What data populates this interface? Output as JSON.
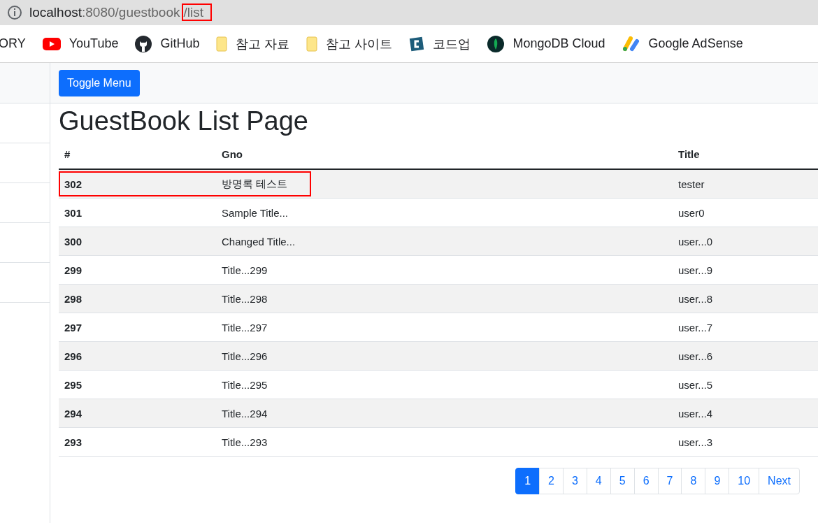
{
  "address_bar": {
    "host": "localhost",
    "path": ":8080/guestbook",
    "highlighted_part": "/list"
  },
  "bookmarks": [
    {
      "kind": "text",
      "label": "ORY"
    },
    {
      "kind": "youtube",
      "label": "YouTube"
    },
    {
      "kind": "github",
      "label": "GitHub"
    },
    {
      "kind": "folder",
      "label": "참고 자료"
    },
    {
      "kind": "folder",
      "label": "참고 사이트"
    },
    {
      "kind": "codeup",
      "label": "코드업"
    },
    {
      "kind": "mongodb",
      "label": "MongoDB Cloud"
    },
    {
      "kind": "adsense",
      "label": "Google AdSense"
    }
  ],
  "toggle_button": "Toggle Menu",
  "page_title": "GuestBook List Page",
  "table": {
    "columns": [
      "#",
      "Gno",
      "Title"
    ],
    "rows": [
      {
        "cells": [
          "302",
          "방명록 테스트",
          "tester"
        ],
        "highlighted": true
      },
      {
        "cells": [
          "301",
          "Sample Title...",
          "user0"
        ],
        "highlighted": false
      },
      {
        "cells": [
          "300",
          "Changed Title...",
          "user...0"
        ],
        "highlighted": false
      },
      {
        "cells": [
          "299",
          "Title...299",
          "user...9"
        ],
        "highlighted": false
      },
      {
        "cells": [
          "298",
          "Title...298",
          "user...8"
        ],
        "highlighted": false
      },
      {
        "cells": [
          "297",
          "Title...297",
          "user...7"
        ],
        "highlighted": false
      },
      {
        "cells": [
          "296",
          "Title...296",
          "user...6"
        ],
        "highlighted": false
      },
      {
        "cells": [
          "295",
          "Title...295",
          "user...5"
        ],
        "highlighted": false
      },
      {
        "cells": [
          "294",
          "Title...294",
          "user...4"
        ],
        "highlighted": false
      },
      {
        "cells": [
          "293",
          "Title...293",
          "user...3"
        ],
        "highlighted": false
      }
    ]
  },
  "pagination": [
    {
      "label": "1",
      "selected": true
    },
    {
      "label": "2",
      "selected": false
    },
    {
      "label": "3",
      "selected": false
    },
    {
      "label": "4",
      "selected": false
    },
    {
      "label": "5",
      "selected": false
    },
    {
      "label": "6",
      "selected": false
    },
    {
      "label": "7",
      "selected": false
    },
    {
      "label": "8",
      "selected": false
    },
    {
      "label": "9",
      "selected": false
    },
    {
      "label": "10",
      "selected": false
    },
    {
      "label": "Next",
      "selected": false
    }
  ]
}
